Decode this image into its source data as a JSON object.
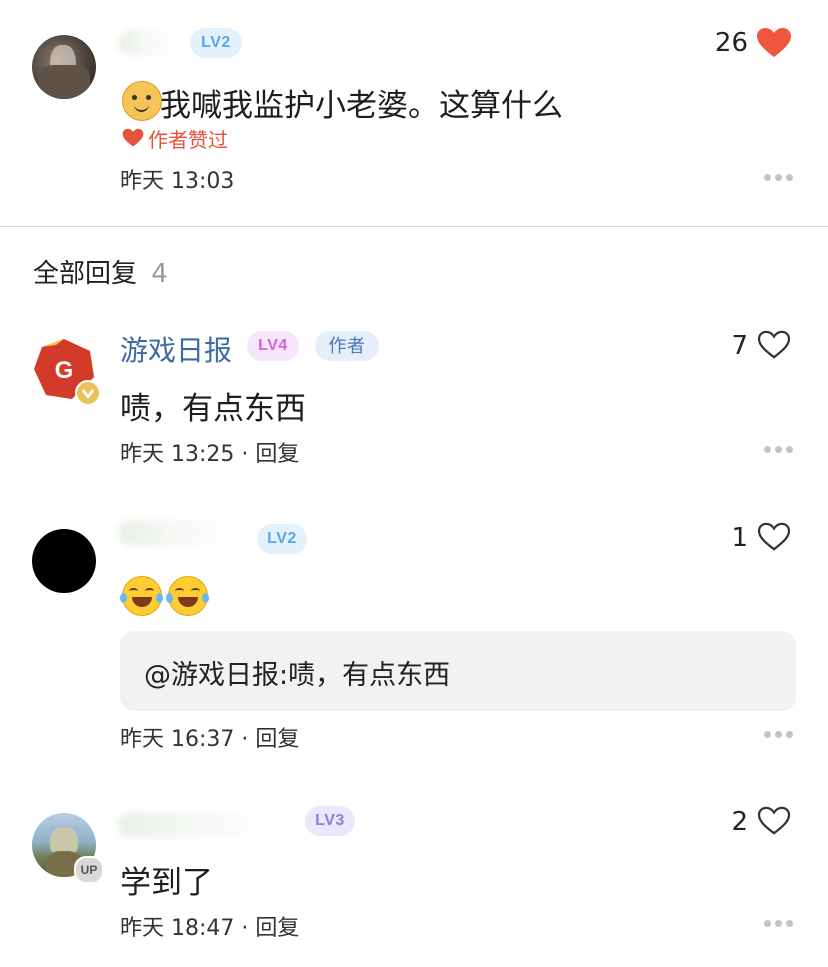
{
  "top_comment": {
    "level": "LV2",
    "likes": "26",
    "text": "我喊我监护小老婆。这算什么",
    "author_liked": "作者赞过",
    "time": "昨天 13:03"
  },
  "replies_header": {
    "label": "全部回复",
    "count": "4"
  },
  "replies": [
    {
      "name": "游戏日报",
      "level": "LV4",
      "tag": "作者",
      "likes": "7",
      "text": "啧，有点东西",
      "meta": "昨天 13:25 · 回复"
    },
    {
      "level": "LV2",
      "likes": "1",
      "quote": "@游戏日报:啧，有点东西",
      "meta": "昨天 16:37 · 回复"
    },
    {
      "level": "LV3",
      "likes": "2",
      "text": "学到了",
      "meta": "昨天 18:47 · 回复",
      "up_badge": "UP"
    }
  ],
  "colors": {
    "heart_filled": "#f0573e",
    "author_liked": "#e5533d",
    "name_blue": "#3f6aa8"
  },
  "icons": [
    "heart-filled-icon",
    "heart-outline-icon",
    "more-icon",
    "verified-icon"
  ]
}
